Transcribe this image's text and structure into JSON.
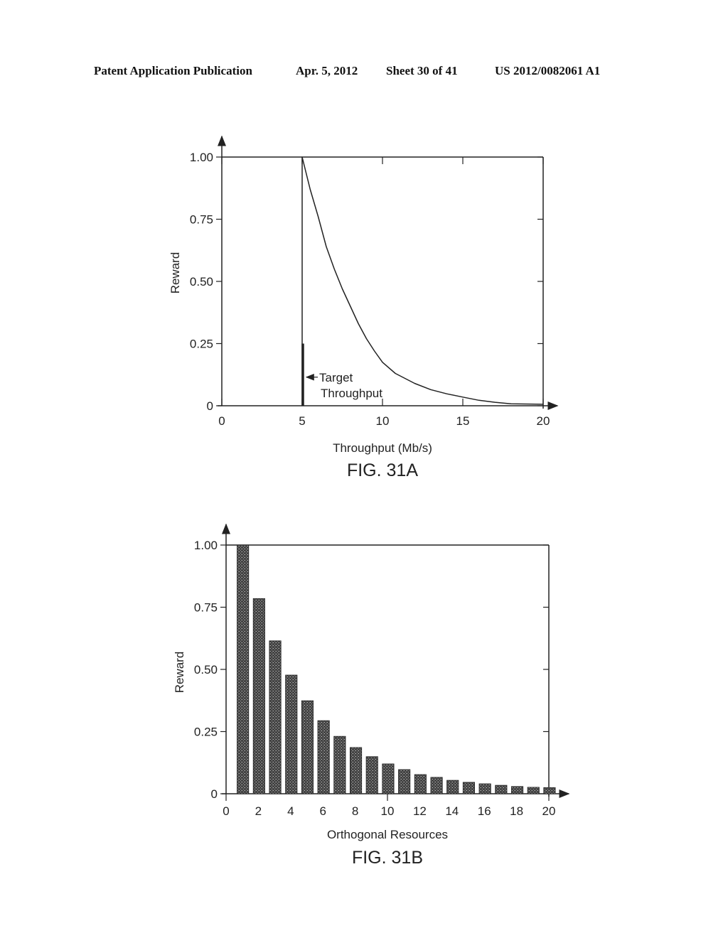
{
  "header": {
    "publication": "Patent Application Publication",
    "date": "Apr. 5, 2012",
    "sheet": "Sheet 30 of 41",
    "number": "US 2012/0082061 A1"
  },
  "chart_data": [
    {
      "id": "fig31a",
      "type": "line",
      "figure_label": "FIG. 31A",
      "title": "",
      "xlabel": "Throughput (Mb/s)",
      "ylabel": "Reward",
      "xlim": [
        0,
        20
      ],
      "ylim": [
        0,
        1.0
      ],
      "xticks": [
        0,
        5,
        10,
        15,
        20
      ],
      "xtick_labels": [
        "0",
        "5",
        "10",
        "15",
        "20"
      ],
      "yticks": [
        0,
        0.25,
        0.5,
        0.75,
        1.0
      ],
      "ytick_labels": [
        "0",
        "0.25",
        "0.50",
        "0.75",
        "1.00"
      ],
      "grid": false,
      "series": [
        {
          "name": "Reward",
          "x": [
            5,
            5,
            5.5,
            6,
            6.5,
            7,
            7.5,
            8,
            8.5,
            9,
            9.5,
            10,
            10.8,
            12,
            13,
            14,
            15,
            16,
            17,
            18,
            20
          ],
          "y": [
            0,
            1.0,
            0.87,
            0.76,
            0.64,
            0.55,
            0.47,
            0.4,
            0.33,
            0.27,
            0.22,
            0.175,
            0.13,
            0.09,
            0.065,
            0.048,
            0.035,
            0.022,
            0.014,
            0.008,
            0.006
          ]
        }
      ],
      "annotations": [
        {
          "text_lines": [
            "Target",
            "Throughput"
          ],
          "x": 5,
          "y_top": 0.25,
          "arrow": "left"
        }
      ]
    },
    {
      "id": "fig31b",
      "type": "bar",
      "figure_label": "FIG. 31B",
      "title": "",
      "xlabel": "Orthogonal Resources",
      "ylabel": "Reward",
      "xlim": [
        0,
        20
      ],
      "ylim": [
        0,
        1.0
      ],
      "xticks": [
        0,
        2,
        4,
        6,
        8,
        10,
        12,
        14,
        16,
        18,
        20
      ],
      "xtick_labels": [
        "0",
        "2",
        "4",
        "6",
        "8",
        "10",
        "12",
        "14",
        "16",
        "18",
        "20"
      ],
      "yticks": [
        0,
        0.25,
        0.5,
        0.75,
        1.0
      ],
      "ytick_labels": [
        "0",
        "0.25",
        "0.50",
        "0.75",
        "1.00"
      ],
      "grid": false,
      "categories": [
        1,
        2,
        3,
        4,
        5,
        6,
        7,
        8,
        9,
        10,
        11,
        12,
        13,
        14,
        15,
        16,
        17,
        18,
        19,
        20
      ],
      "values": [
        1.0,
        0.785,
        0.615,
        0.477,
        0.374,
        0.294,
        0.231,
        0.186,
        0.149,
        0.12,
        0.097,
        0.077,
        0.066,
        0.054,
        0.046,
        0.04,
        0.034,
        0.029,
        0.026,
        0.025
      ],
      "bar_color": "#555555"
    }
  ]
}
